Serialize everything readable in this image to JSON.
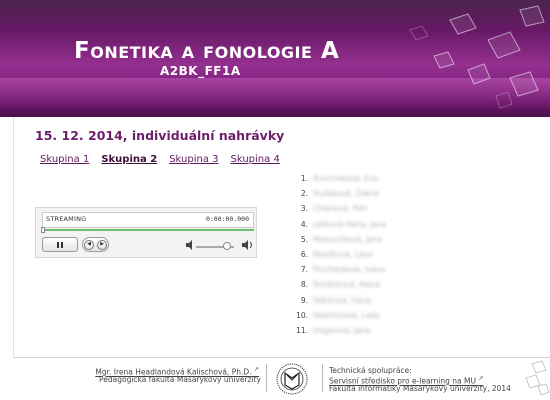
{
  "header": {
    "title": "Fonetika a fonologie A",
    "code": "A2BK_FF1A"
  },
  "main": {
    "heading": "15. 12. 2014, individuální nahrávky",
    "tabs": [
      {
        "label": "Skupina 1",
        "active": false
      },
      {
        "label": "Skupina 2",
        "active": true
      },
      {
        "label": "Skupina 3",
        "active": false
      },
      {
        "label": "Skupina 4",
        "active": false
      }
    ]
  },
  "player": {
    "status": "STREAMING",
    "time": "0:00:00.000",
    "progress": 0.0,
    "volume": 0.75,
    "icons": [
      "pause-icon",
      "previous-icon",
      "next-icon",
      "volume-mute-icon",
      "volume-high-icon"
    ]
  },
  "students": [
    {
      "num": "1.",
      "name": "Anonimková, Eva"
    },
    {
      "num": "2.",
      "name": "Hudáková, Zdena"
    },
    {
      "num": "3.",
      "name": "Chlanová, Petr"
    },
    {
      "num": "4.",
      "name": "Lášková Hana, Jana"
    },
    {
      "num": "5.",
      "name": "Makovičková, Jana"
    },
    {
      "num": "6.",
      "name": "Mazlíková, Libor"
    },
    {
      "num": "7.",
      "name": "Procházková, Ivana"
    },
    {
      "num": "8.",
      "name": "Šimánková, Alena"
    },
    {
      "num": "9.",
      "name": "Štěrbová, Hana"
    },
    {
      "num": "10.",
      "name": "Valentínová, Lada"
    },
    {
      "num": "11.",
      "name": "Ungerová, Jana"
    }
  ],
  "footer": {
    "author": "Mgr. Irena Headlandová Kalischová, Ph.D.",
    "faculty": "Pedagogická fakulta Masarykovy univerzity",
    "tech_label": "Technická spolupráce:",
    "tech_link": "Servisní středisko pro e-learning na MU",
    "tech_faculty": "Fakulta informatiky Masarykovy univerzity, 2014",
    "ext_glyph": "↗"
  },
  "colors": {
    "accent": "#6d1e6b",
    "banner_dark": "#3a0b3c",
    "banner_light": "#94308f",
    "progress": "#6fc06b"
  }
}
